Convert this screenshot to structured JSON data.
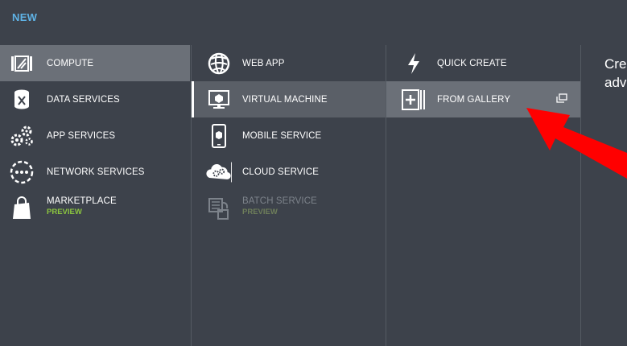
{
  "header": {
    "title": "NEW"
  },
  "categories": [
    {
      "label": "COMPUTE",
      "icon": "compute-icon"
    },
    {
      "label": "DATA SERVICES",
      "icon": "data-services-icon"
    },
    {
      "label": "APP SERVICES",
      "icon": "app-services-icon"
    },
    {
      "label": "NETWORK SERVICES",
      "icon": "network-services-icon"
    },
    {
      "label": "MARKETPLACE",
      "sub": "PREVIEW",
      "icon": "marketplace-icon"
    }
  ],
  "compute_items": [
    {
      "label": "WEB APP",
      "icon": "web-app-icon"
    },
    {
      "label": "VIRTUAL MACHINE",
      "icon": "virtual-machine-icon"
    },
    {
      "label": "MOBILE SERVICE",
      "icon": "mobile-service-icon"
    },
    {
      "label": "CLOUD SERVICE",
      "icon": "cloud-service-icon"
    },
    {
      "label": "BATCH SERVICE",
      "sub": "PREVIEW",
      "icon": "batch-service-icon"
    }
  ],
  "vm_options": [
    {
      "label": "QUICK CREATE",
      "icon": "lightning-icon"
    },
    {
      "label": "FROM GALLERY",
      "icon": "gallery-icon"
    }
  ],
  "description": {
    "line1": "Crea",
    "line2": "adva"
  },
  "colors": {
    "title": "#5fb3e6",
    "preview": "#8cc63f",
    "background": "#3d424b",
    "annotation": "#ff0000"
  }
}
